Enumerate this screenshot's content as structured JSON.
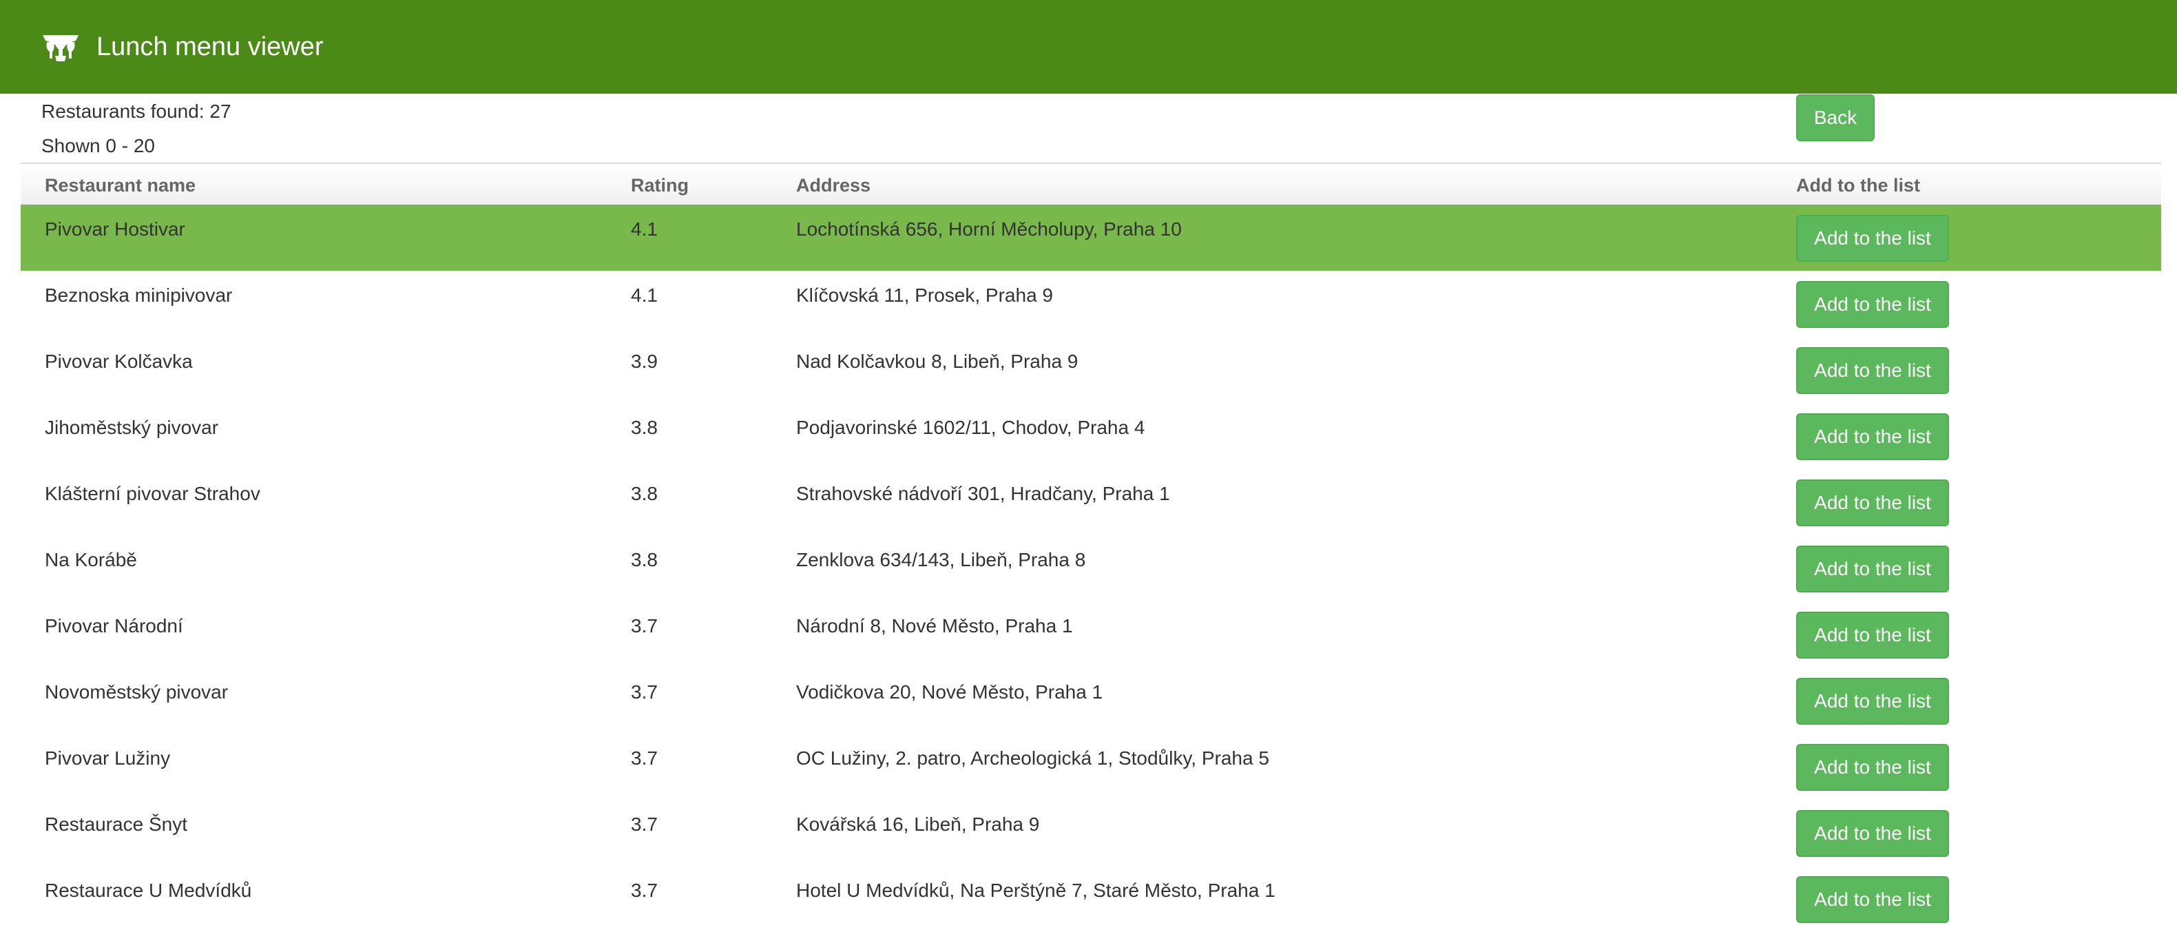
{
  "header": {
    "title": "Lunch menu viewer",
    "icon": "dining-icon",
    "bg_color": "#4b8a17"
  },
  "info": {
    "found": "Restaurants found: 27",
    "shown": "Shown 0 - 20"
  },
  "back_label": "Back",
  "table": {
    "columns": [
      "Restaurant name",
      "Rating",
      "Address",
      "Add to the list"
    ],
    "highlight_color": "#79b94b",
    "button_color": "#5cb85c",
    "rows": [
      {
        "name": "Pivovar Hostivar",
        "rating": "4.1",
        "address": "Lochotínská 656, Horní Měcholupy, Praha 10",
        "button": "Add to the list"
      },
      {
        "name": "Beznoska minipivovar",
        "rating": "4.1",
        "address": "Klíčovská 11, Prosek, Praha 9",
        "button": "Add to the list"
      },
      {
        "name": "Pivovar Kolčavka",
        "rating": "3.9",
        "address": "Nad Kolčavkou 8, Libeň, Praha 9",
        "button": "Add to the list"
      },
      {
        "name": "Jihoměstský pivovar",
        "rating": "3.8",
        "address": "Podjavorinské 1602/11, Chodov, Praha 4",
        "button": "Add to the list"
      },
      {
        "name": "Klášterní pivovar Strahov",
        "rating": "3.8",
        "address": "Strahovské nádvoří 301, Hradčany, Praha 1",
        "button": "Add to the list"
      },
      {
        "name": "Na Korábě",
        "rating": "3.8",
        "address": "Zenklova 634/143, Libeň, Praha 8",
        "button": "Add to the list"
      },
      {
        "name": "Pivovar Národní",
        "rating": "3.7",
        "address": "Národní 8, Nové Město, Praha 1",
        "button": "Add to the list"
      },
      {
        "name": "Novoměstský pivovar",
        "rating": "3.7",
        "address": "Vodičkova 20, Nové Město, Praha 1",
        "button": "Add to the list"
      },
      {
        "name": "Pivovar Lužiny",
        "rating": "3.7",
        "address": "OC Lužiny, 2. patro, Archeologická 1, Stodůlky, Praha 5",
        "button": "Add to the list"
      },
      {
        "name": "Restaurace Šnyt",
        "rating": "3.7",
        "address": "Kovářská 16, Libeň, Praha 9",
        "button": "Add to the list"
      },
      {
        "name": "Restaurace U Medvídků",
        "rating": "3.7",
        "address": "Hotel U Medvídků, Na Perštýně 7, Staré Město, Praha 1",
        "button": "Add to the list"
      }
    ]
  }
}
